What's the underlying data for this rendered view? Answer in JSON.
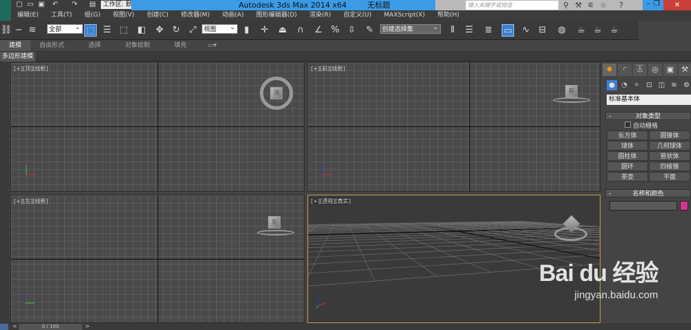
{
  "titlebar": {
    "workspace": "工作区: 默认",
    "app_title": "Autodesk 3ds Max  2014 x64",
    "doc_title": "无标题",
    "search_placeholder": "键入关键字或短语",
    "close": "✕"
  },
  "menu": [
    "编辑(E)",
    "工具(T)",
    "组(G)",
    "视图(V)",
    "创建(C)",
    "修改器(M)",
    "动画(A)",
    "图形编辑器(D)",
    "渲染(R)",
    "自定义(U)",
    "MAXScript(X)",
    "帮助(H)"
  ],
  "toolbar": {
    "selection_filter": "全部",
    "ref_coord": "视图",
    "named_selection": "创建选择集"
  },
  "ribbon": {
    "tabs": [
      "建模",
      "自由形式",
      "选择",
      "对象绘制",
      "填充"
    ],
    "panel_label": "多边形建模"
  },
  "viewports": [
    {
      "label": "[+][顶][线框]",
      "cube": "顶"
    },
    {
      "label": "[+][前][线框]",
      "cube": "前"
    },
    {
      "label": "[+][左][线框]",
      "cube": "左"
    },
    {
      "label": "[+][透视][真实]"
    }
  ],
  "command_panel": {
    "category": "标准基本体",
    "object_type_header": "对象类型",
    "autogrid": "自动栅格",
    "buttons": [
      "长方体",
      "圆锥体",
      "球体",
      "几何球体",
      "圆柱体",
      "管状体",
      "圆环",
      "四棱锥",
      "茶壶",
      "平面"
    ],
    "name_color_header": "名称和颜色",
    "object_color": "#d6338f"
  },
  "timeline": {
    "frames": "0 / 100"
  },
  "watermark": {
    "brand": "Bai du 经验",
    "url": "jingyan.baidu.com"
  }
}
